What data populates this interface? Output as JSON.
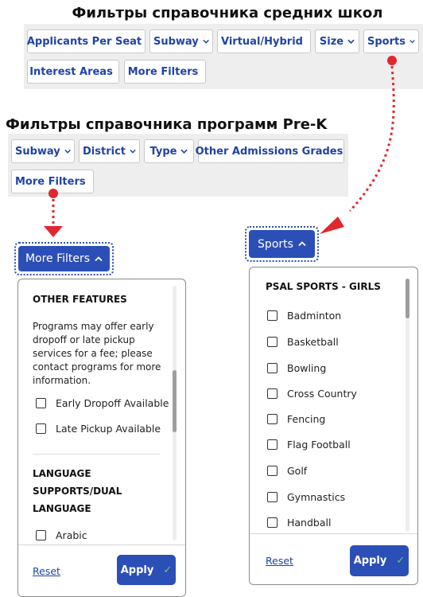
{
  "high_school": {
    "title": "Фильтры справочника средних школ",
    "filters": [
      "Applicants Per Seat",
      "Subway",
      "Virtual/Hybrid",
      "Size",
      "Sports",
      "Interest Areas",
      "More Filters"
    ]
  },
  "prek": {
    "title": "Фильтры справочника программ Pre-K",
    "filters": [
      "Subway",
      "District",
      "Type",
      "Other Admissions Grades",
      "More Filters"
    ]
  },
  "more_filters_panel": {
    "button_label": "More Filters",
    "section1_heading": "OTHER FEATURES",
    "section1_description": "Programs may offer early dropoff or late pickup services for a fee; please contact programs for more information.",
    "section1_options": [
      "Early Dropoff Available",
      "Late Pickup Available"
    ],
    "section2_heading": "LANGUAGE SUPPORTS/DUAL LANGUAGE",
    "section2_options": [
      "Arabic"
    ],
    "reset_label": "Reset",
    "apply_label": "Apply",
    "scroll_position": 0.45
  },
  "sports_panel": {
    "button_label": "Sports",
    "heading": "PSAL SPORTS - GIRLS",
    "options": [
      "Badminton",
      "Basketball",
      "Bowling",
      "Cross Country",
      "Fencing",
      "Flag Football",
      "Golf",
      "Gymnastics",
      "Handball"
    ],
    "reset_label": "Reset",
    "apply_label": "Apply",
    "scroll_position": 0.0
  },
  "colors": {
    "accent": "#2c4fb7",
    "link": "#1f44a6",
    "arrow": "#e0282e",
    "check": "#5fd16d",
    "bar_bg": "#eeeeee"
  }
}
